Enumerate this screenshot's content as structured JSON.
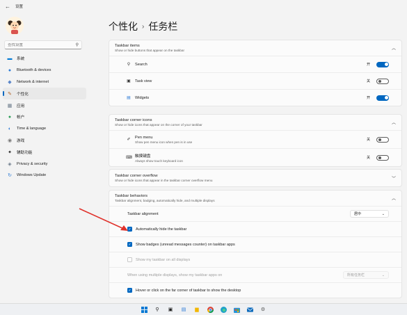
{
  "window": {
    "title": "设置",
    "back_icon": "back-arrow-icon"
  },
  "sidebar": {
    "search_placeholder": "查找设置",
    "items": [
      {
        "label": "系统",
        "icon": "monitor-icon",
        "color": "#0078d4",
        "active": false
      },
      {
        "label": "Bluetooth & devices",
        "icon": "bluetooth-icon",
        "color": "#2d7bd6",
        "active": false
      },
      {
        "label": "Network & internet",
        "icon": "wifi-icon",
        "color": "#5b86c9",
        "active": false
      },
      {
        "label": "个性化",
        "icon": "brush-icon",
        "color": "#b0652a",
        "active": true
      },
      {
        "label": "应用",
        "icon": "apps-icon",
        "color": "#6b7a8a",
        "active": false
      },
      {
        "label": "帐户",
        "icon": "account-icon",
        "color": "#2f9e5a",
        "active": false
      },
      {
        "label": "Time & language",
        "icon": "globe-icon",
        "color": "#2d7bd6",
        "active": false
      },
      {
        "label": "游戏",
        "icon": "gamepad-icon",
        "color": "#777777",
        "active": false
      },
      {
        "label": "辅助功能",
        "icon": "accessibility-icon",
        "color": "#1b1b1b",
        "active": false
      },
      {
        "label": "Privacy & security",
        "icon": "shield-icon",
        "color": "#6b7a8a",
        "active": false
      },
      {
        "label": "Windows Update",
        "icon": "update-icon",
        "color": "#2d7bd6",
        "active": false
      }
    ]
  },
  "breadcrumb": {
    "parent": "个性化",
    "separator": "›",
    "current": "任务栏"
  },
  "taskbar_items": {
    "title": "Taskbar items",
    "subtitle": "Show or hide buttons that appear on the taskbar",
    "rows": [
      {
        "label": "Search",
        "icon": "search-icon",
        "state": "开",
        "on": true
      },
      {
        "label": "Task view",
        "icon": "task-view-icon",
        "state": "关",
        "on": false
      },
      {
        "label": "Widgets",
        "icon": "widgets-icon",
        "state": "开",
        "on": true
      }
    ]
  },
  "corner_icons": {
    "title": "Taskbar corner icons",
    "subtitle": "Show or hide icons that appear on the corner of your taskbar",
    "rows": [
      {
        "label": "Pen menu",
        "sub": "Show pen menu icon when pen is in use",
        "icon": "pen-icon",
        "state": "关",
        "on": false
      },
      {
        "label": "触摸键盘",
        "sub": "Always show touch keyboard icon",
        "icon": "keyboard-icon",
        "state": "关",
        "on": false
      }
    ]
  },
  "corner_overflow": {
    "title": "Taskbar corner overflow",
    "subtitle": "Show or hide icons that appear in the taskbar corner overflow menu"
  },
  "behaviors": {
    "title": "Taskbar behaviors",
    "subtitle": "Taskbar alignment, badging, automatically hide, and multiple displays",
    "alignment_label": "Taskbar alignment",
    "alignment_value": "居中",
    "auto_hide": "Automatically hide the taskbar",
    "badges": "Show badges (unread messages counter) on taskbar apps",
    "all_displays": "Show my taskbar on all displays",
    "multi_display_label": "When using multiple displays, show my taskbar apps on",
    "multi_display_value": "所有任务栏",
    "far_corner": "Hover or click on the far corner of taskbar to show the desktop"
  },
  "colors": {
    "accent": "#0067c0",
    "annotation_arrow": "#e0312b"
  },
  "taskbar_icons": [
    "windows-start-icon",
    "search-icon",
    "task-view-icon",
    "widgets-icon",
    "file-explorer-icon",
    "chrome-icon",
    "edge-icon",
    "store-icon",
    "mail-icon",
    "settings-icon"
  ]
}
